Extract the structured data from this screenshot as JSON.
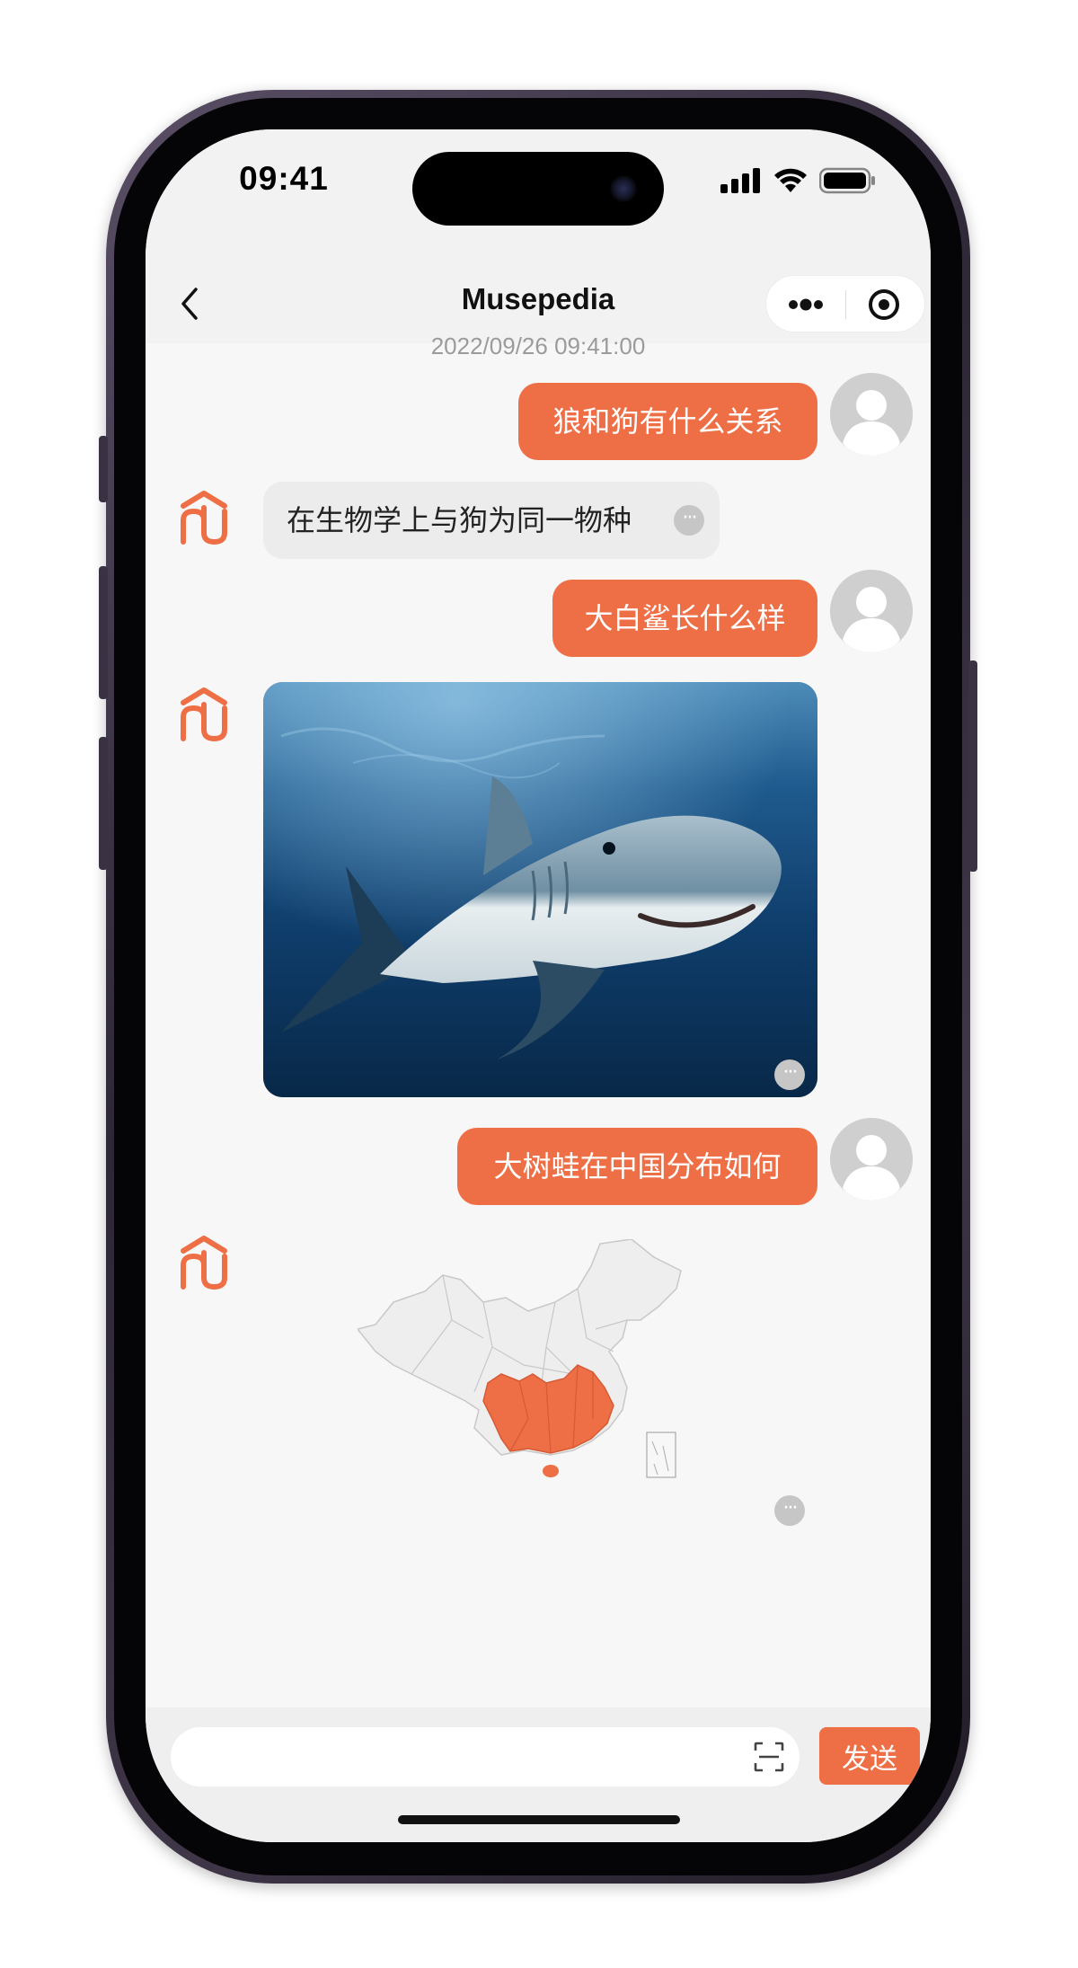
{
  "status_bar": {
    "time": "09:41"
  },
  "nav": {
    "title": "Musepedia"
  },
  "chat": {
    "timestamp": "2022/09/26 09:41:00",
    "messages": [
      {
        "role": "user",
        "text": "狼和狗有什么关系"
      },
      {
        "role": "bot",
        "text": "在生物学上与狗为同一物种"
      },
      {
        "role": "user",
        "text": "大白鲨长什么样"
      },
      {
        "role": "bot",
        "type": "image",
        "image": "great-white-shark-photo"
      },
      {
        "role": "user",
        "text": "大树蛙在中国分布如何"
      },
      {
        "role": "bot",
        "type": "map",
        "image": "china-distribution-map"
      }
    ]
  },
  "input_bar": {
    "placeholder": "",
    "send_label": "发送"
  },
  "colors": {
    "accent": "#ee6e45",
    "bot_bubble": "#ececec",
    "background": "#f7f7f7"
  }
}
